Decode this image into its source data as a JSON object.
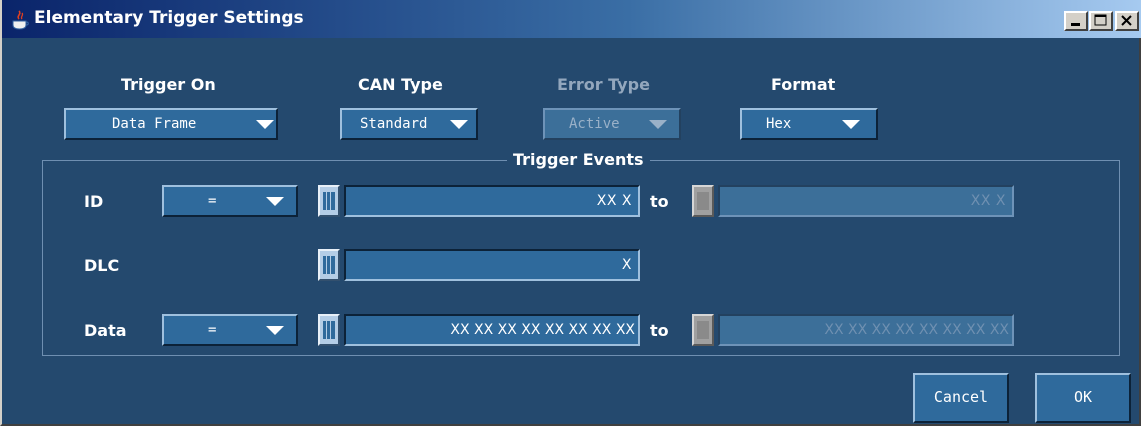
{
  "window": {
    "title": "Elementary Trigger Settings",
    "controls": [
      "minimize",
      "maximize",
      "close"
    ]
  },
  "top_controls": {
    "trigger_on": {
      "label": "Trigger On",
      "value": "Data Frame"
    },
    "can_type": {
      "label": "CAN Type",
      "value": "Standard"
    },
    "error_type": {
      "label": "Error Type",
      "value": "Active",
      "enabled": false
    },
    "format": {
      "label": "Format",
      "value": "Hex"
    }
  },
  "trigger_events": {
    "title": "Trigger Events",
    "id": {
      "label": "ID",
      "operator": "=",
      "value": "XX X",
      "to_label": "to",
      "to_value": "XX X"
    },
    "dlc": {
      "label": "DLC",
      "value": "X"
    },
    "data": {
      "label": "Data",
      "operator": "=",
      "value": "XX XX XX XX XX XX XX XX",
      "to_label": "to",
      "to_value": "XX XX XX XX XX XX XX XX"
    }
  },
  "buttons": {
    "cancel": "Cancel",
    "ok": "OK"
  },
  "colors": {
    "background": "#24496e",
    "control": "#2f6a9c",
    "titlebar_start": "#0a246a",
    "titlebar_end": "#a6caf0"
  }
}
